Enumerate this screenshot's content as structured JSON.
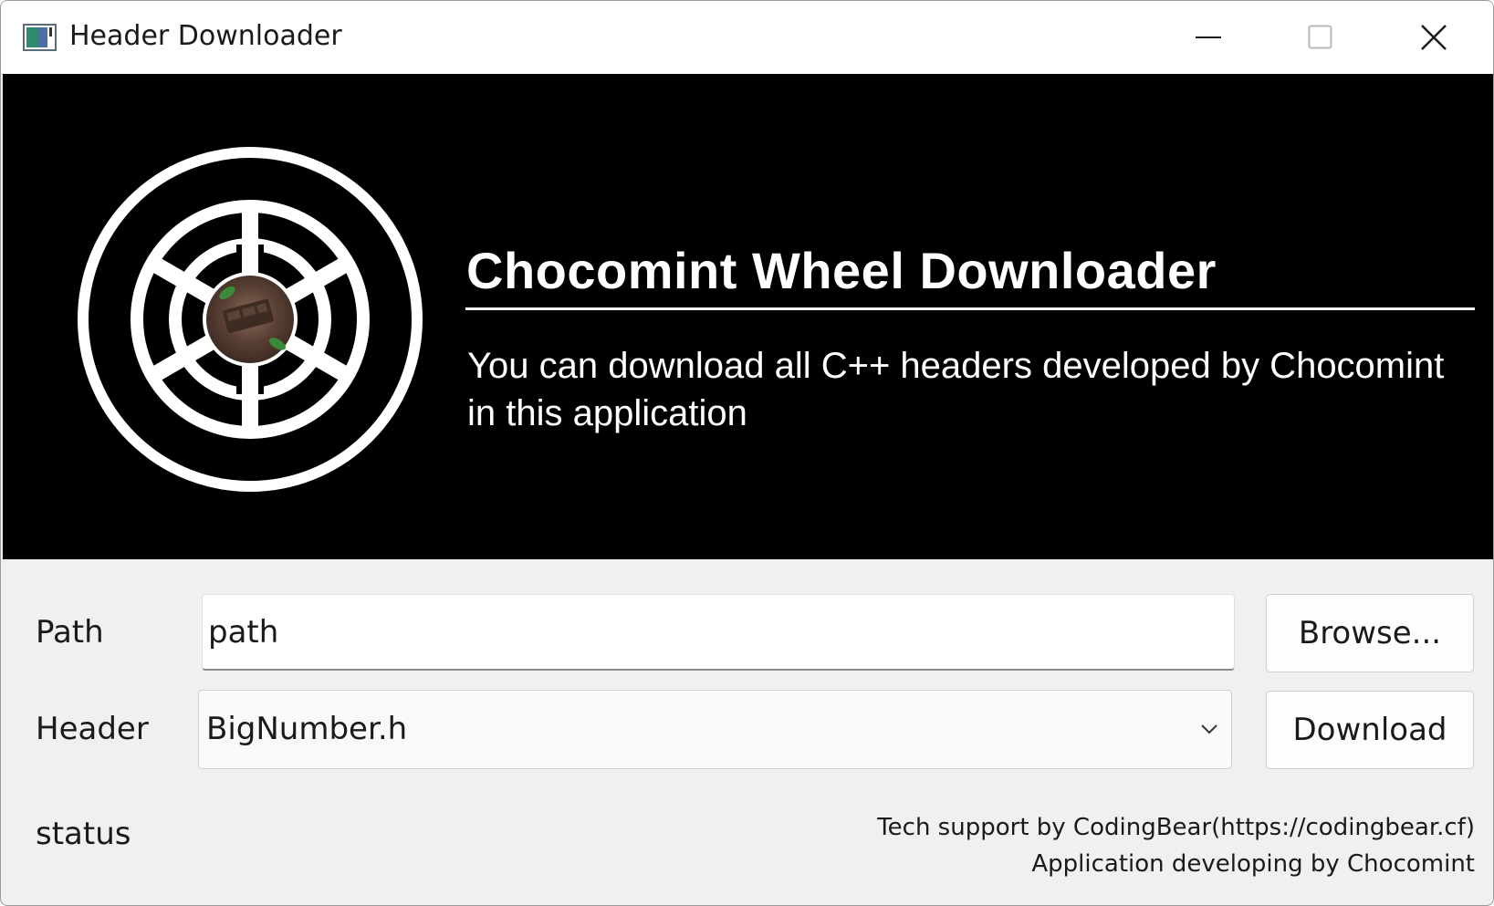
{
  "window": {
    "title": "Header Downloader",
    "controls": [
      "minimize-icon",
      "maximize-icon",
      "close-icon"
    ]
  },
  "banner": {
    "title": "Chocomint Wheel Downloader",
    "description": "You can download all C++ headers developed by Chocomint in this application",
    "logo": "chocomint-wheel-logo",
    "background_color": "#000000",
    "text_color": "#ffffff"
  },
  "form": {
    "path_label": "Path",
    "path_value": "path",
    "browse_label": "Browse...",
    "header_label": "Header",
    "header_selected": "BigNumber.h",
    "download_label": "Download",
    "status_label": "status"
  },
  "credits": {
    "line1": "Tech support by CodingBear(https://codingbear.cf)",
    "line2": "Application developing by Chocomint"
  }
}
